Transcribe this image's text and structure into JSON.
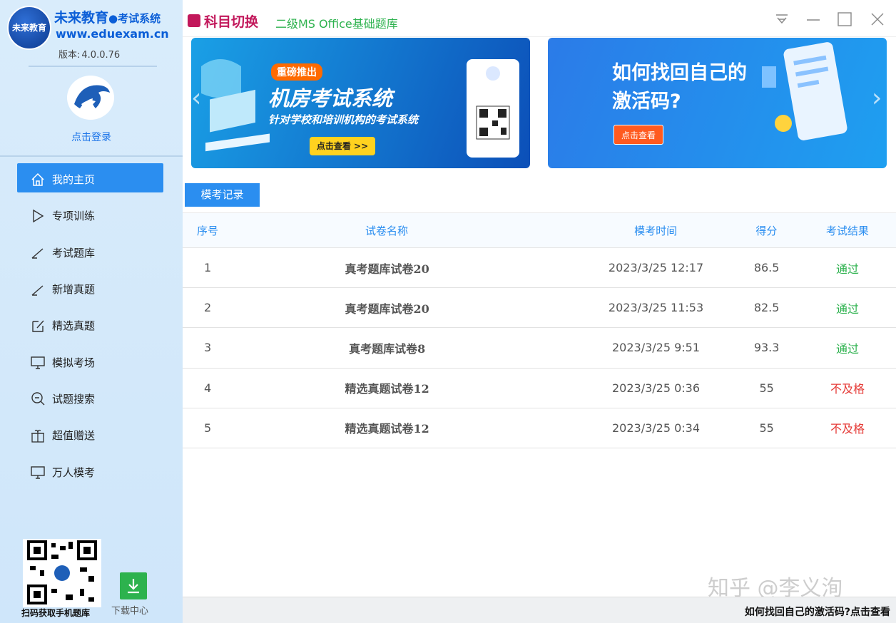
{
  "sidebar": {
    "brand_name": "未来教育",
    "brand_sub": "●考试系统",
    "brand_logo_text": "未来教育",
    "brand_url": "www.eduexam.cn",
    "version_label": "版本:",
    "version": "4.0.0.76",
    "login_label": "点击登录",
    "items": [
      {
        "label": "我的主页",
        "icon": "home-icon",
        "active": true
      },
      {
        "label": "专项训练",
        "icon": "play-icon",
        "active": false
      },
      {
        "label": "考试题库",
        "icon": "pen-icon",
        "active": false
      },
      {
        "label": "新增真题",
        "icon": "pen-icon",
        "active": false
      },
      {
        "label": "精选真题",
        "icon": "edit-box-icon",
        "active": false
      },
      {
        "label": "模拟考场",
        "icon": "monitor-icon",
        "active": false
      },
      {
        "label": "试题搜索",
        "icon": "search-icon",
        "active": false
      },
      {
        "label": "超值赠送",
        "icon": "gift-icon",
        "active": false
      },
      {
        "label": "万人模考",
        "icon": "monitor-icon",
        "active": false
      }
    ],
    "qr_label": "扫码获取手机题库",
    "download_label": "下载中心"
  },
  "header": {
    "switch_label": "科目切换",
    "subject": "二级MS Office基础题库"
  },
  "banners": {
    "banner1": {
      "tag": "重磅推出",
      "title": "机房考试系统",
      "subtitle": "针对学校和培训机构的考试系统",
      "button": "点击查看 >>"
    },
    "banner2": {
      "title_line1": "如何找回自己的",
      "title_line2": "激活码?",
      "button": "点击查看"
    }
  },
  "records": {
    "tab_label": "模考记录",
    "columns": [
      "序号",
      "试卷名称",
      "模考时间",
      "得分",
      "考试结果"
    ],
    "rows": [
      {
        "no": "1",
        "name": "真考题库试卷20",
        "time": "2023/3/25 12:17",
        "score": "86.5",
        "result": "通过",
        "status": "pass"
      },
      {
        "no": "2",
        "name": "真考题库试卷20",
        "time": "2023/3/25 11:53",
        "score": "82.5",
        "result": "通过",
        "status": "pass"
      },
      {
        "no": "3",
        "name": "真考题库试卷8",
        "time": "2023/3/25 9:51",
        "score": "93.3",
        "result": "通过",
        "status": "pass"
      },
      {
        "no": "4",
        "name": "精选真题试卷12",
        "time": "2023/3/25 0:36",
        "score": "55",
        "result": "不及格",
        "status": "fail"
      },
      {
        "no": "5",
        "name": "精选真题试卷12",
        "time": "2023/3/25 0:34",
        "score": "55",
        "result": "不及格",
        "status": "fail"
      }
    ]
  },
  "watermark": "知乎 @李义洵",
  "status_link": "如何找回自己的激活码?点击查看",
  "colors": {
    "accent": "#2b8ef0",
    "pass": "#2db24e",
    "fail": "#e53935",
    "switch": "#c2185b"
  }
}
